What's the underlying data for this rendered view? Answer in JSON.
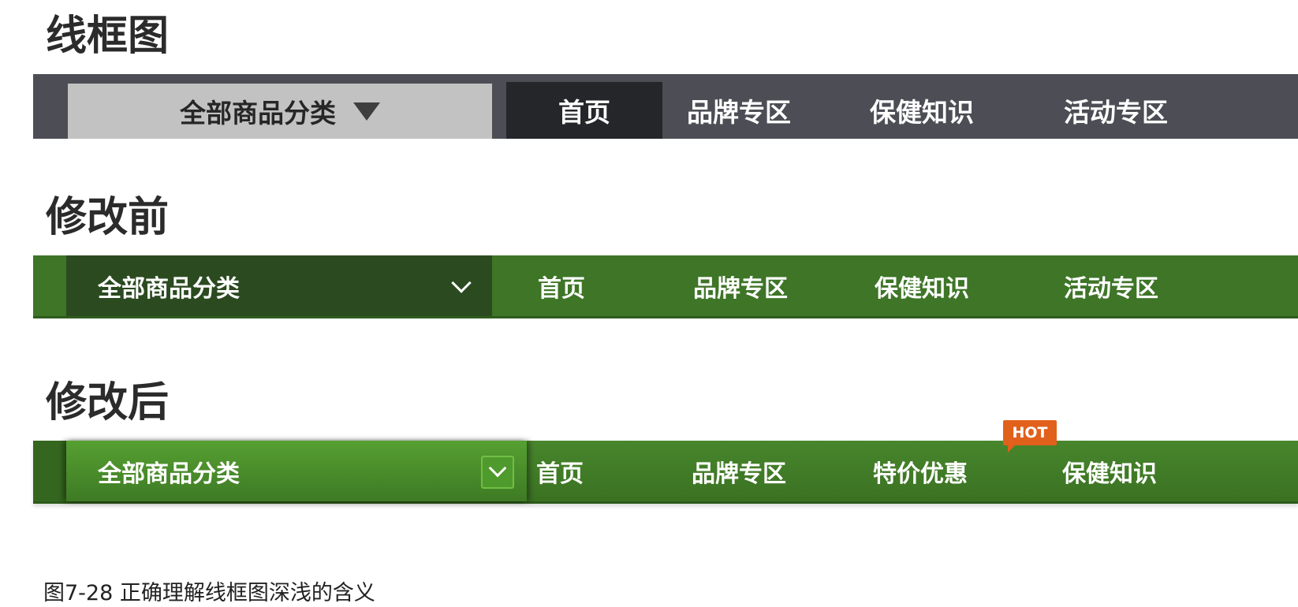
{
  "sections": {
    "wireframe_title": "线框图",
    "before_title": "修改前",
    "after_title": "修改后"
  },
  "wireframe_bar": {
    "category_label": "全部商品分类",
    "nav": [
      "首页",
      "品牌专区",
      "保健知识",
      "活动专区"
    ],
    "active_index": 0
  },
  "before_bar": {
    "category_label": "全部商品分类",
    "nav": [
      "首页",
      "品牌专区",
      "保健知识",
      "活动专区"
    ]
  },
  "after_bar": {
    "category_label": "全部商品分类",
    "nav": [
      "首页",
      "品牌专区",
      "特价优惠",
      "保健知识"
    ],
    "hot_badge": "HOT"
  },
  "colors": {
    "wireframe_bar": "#4d4e55",
    "wireframe_category": "#c2c2c2",
    "wireframe_active": "#25262a",
    "before_bar": "#3e7527",
    "before_category": "#2b4a20",
    "after_bar": "#48862c",
    "hot_badge": "#e1601c"
  },
  "caption": "图7-28 正确理解线框图深浅的含义"
}
